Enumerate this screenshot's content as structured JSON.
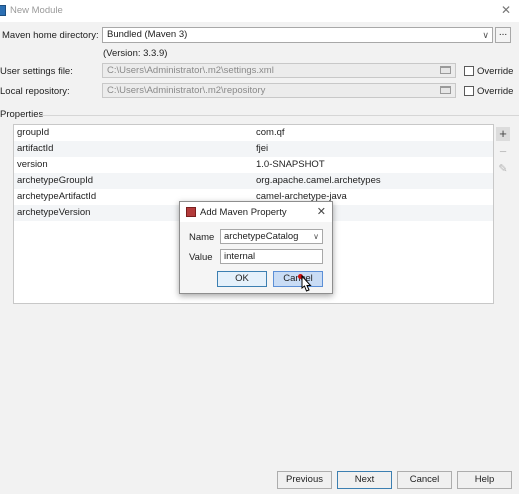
{
  "window": {
    "title": "New Module"
  },
  "maven": {
    "home_label": "Maven home directory:",
    "home_value": "Bundled (Maven 3)",
    "version": "(Version: 3.3.9)",
    "more_label": "...",
    "settings_label": "User settings file:",
    "settings_value": "C:\\Users\\Administrator\\.m2\\settings.xml",
    "override_label": "Override",
    "repo_label": "Local repository:",
    "repo_value": "C:\\Users\\Administrator\\.m2\\repository"
  },
  "properties": {
    "heading": "Properties",
    "rows": [
      {
        "key": "groupId",
        "value": "com.qf"
      },
      {
        "key": "artifactId",
        "value": "fjei"
      },
      {
        "key": "version",
        "value": "1.0-SNAPSHOT"
      },
      {
        "key": "archetypeGroupId",
        "value": "org.apache.camel.archetypes"
      },
      {
        "key": "archetypeArtifactId",
        "value": "camel-archetype-java"
      },
      {
        "key": "archetypeVersion",
        "value": ""
      }
    ],
    "tools": {
      "add": "+",
      "remove": "−",
      "edit": "✎"
    }
  },
  "dialog": {
    "title": "Add Maven Property",
    "name_label": "Name",
    "name_value": "archetypeCatalog",
    "value_label": "Value",
    "value_value": "internal",
    "ok_label": "OK",
    "cancel_label": "Cancel"
  },
  "footer": {
    "previous_label": "Previous",
    "next_label": "Next",
    "cancel_label": "Cancel",
    "help_label": "Help"
  },
  "icons": {
    "app": "module-icon",
    "close": "close-icon",
    "folder": "folder-icon",
    "dialog": "maven-property-icon",
    "cursor": "mouse-pointer-icon"
  },
  "colors": {
    "accent": "#3c7fb1",
    "hover": "#c9dcf5",
    "stripe": "#f3f5f7"
  }
}
